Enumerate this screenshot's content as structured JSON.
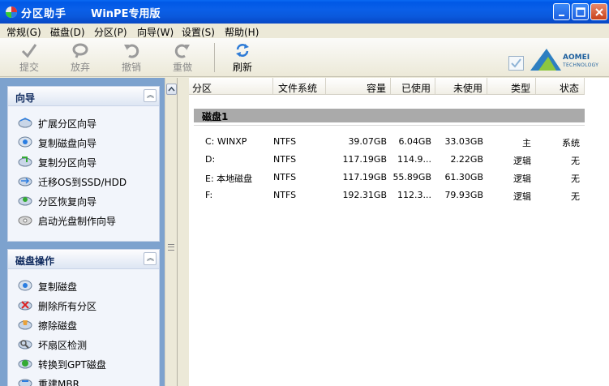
{
  "window": {
    "title": "分区助手",
    "subtitle": "WinPE专用版"
  },
  "menu": [
    "常规(G)",
    "磁盘(D)",
    "分区(P)",
    "向导(W)",
    "设置(S)",
    "帮助(H)"
  ],
  "toolbar": {
    "commit": "提交",
    "discard": "放弃",
    "undo": "撤销",
    "redo": "重做",
    "refresh": "刷新"
  },
  "logo": {
    "name": "AOMEI",
    "sub": "TECHNOLOGY"
  },
  "wizard_panel": {
    "title": "向导",
    "items": [
      "扩展分区向导",
      "复制磁盘向导",
      "复制分区向导",
      "迁移OS到SSD/HDD",
      "分区恢复向导",
      "启动光盘制作向导"
    ]
  },
  "disk_ops_panel": {
    "title": "磁盘操作",
    "items": [
      "复制磁盘",
      "删除所有分区",
      "擦除磁盘",
      "坏扇区检测",
      "转换到GPT磁盘",
      "重建MBR"
    ]
  },
  "table": {
    "headers": [
      "分区",
      "文件系统",
      "容量",
      "已使用",
      "未使用",
      "类型",
      "状态"
    ],
    "disk_label": "磁盘1",
    "rows": [
      [
        "C: WINXP",
        "NTFS",
        "39.07GB",
        "6.04GB",
        "33.03GB",
        "主",
        "系统"
      ],
      [
        "D:",
        "NTFS",
        "117.19GB",
        "114.9...",
        "2.22GB",
        "逻辑",
        "无"
      ],
      [
        "E: 本地磁盘",
        "NTFS",
        "117.19GB",
        "55.89GB",
        "61.30GB",
        "逻辑",
        "无"
      ],
      [
        "F:",
        "NTFS",
        "192.31GB",
        "112.3...",
        "79.93GB",
        "逻辑",
        "无"
      ]
    ]
  }
}
